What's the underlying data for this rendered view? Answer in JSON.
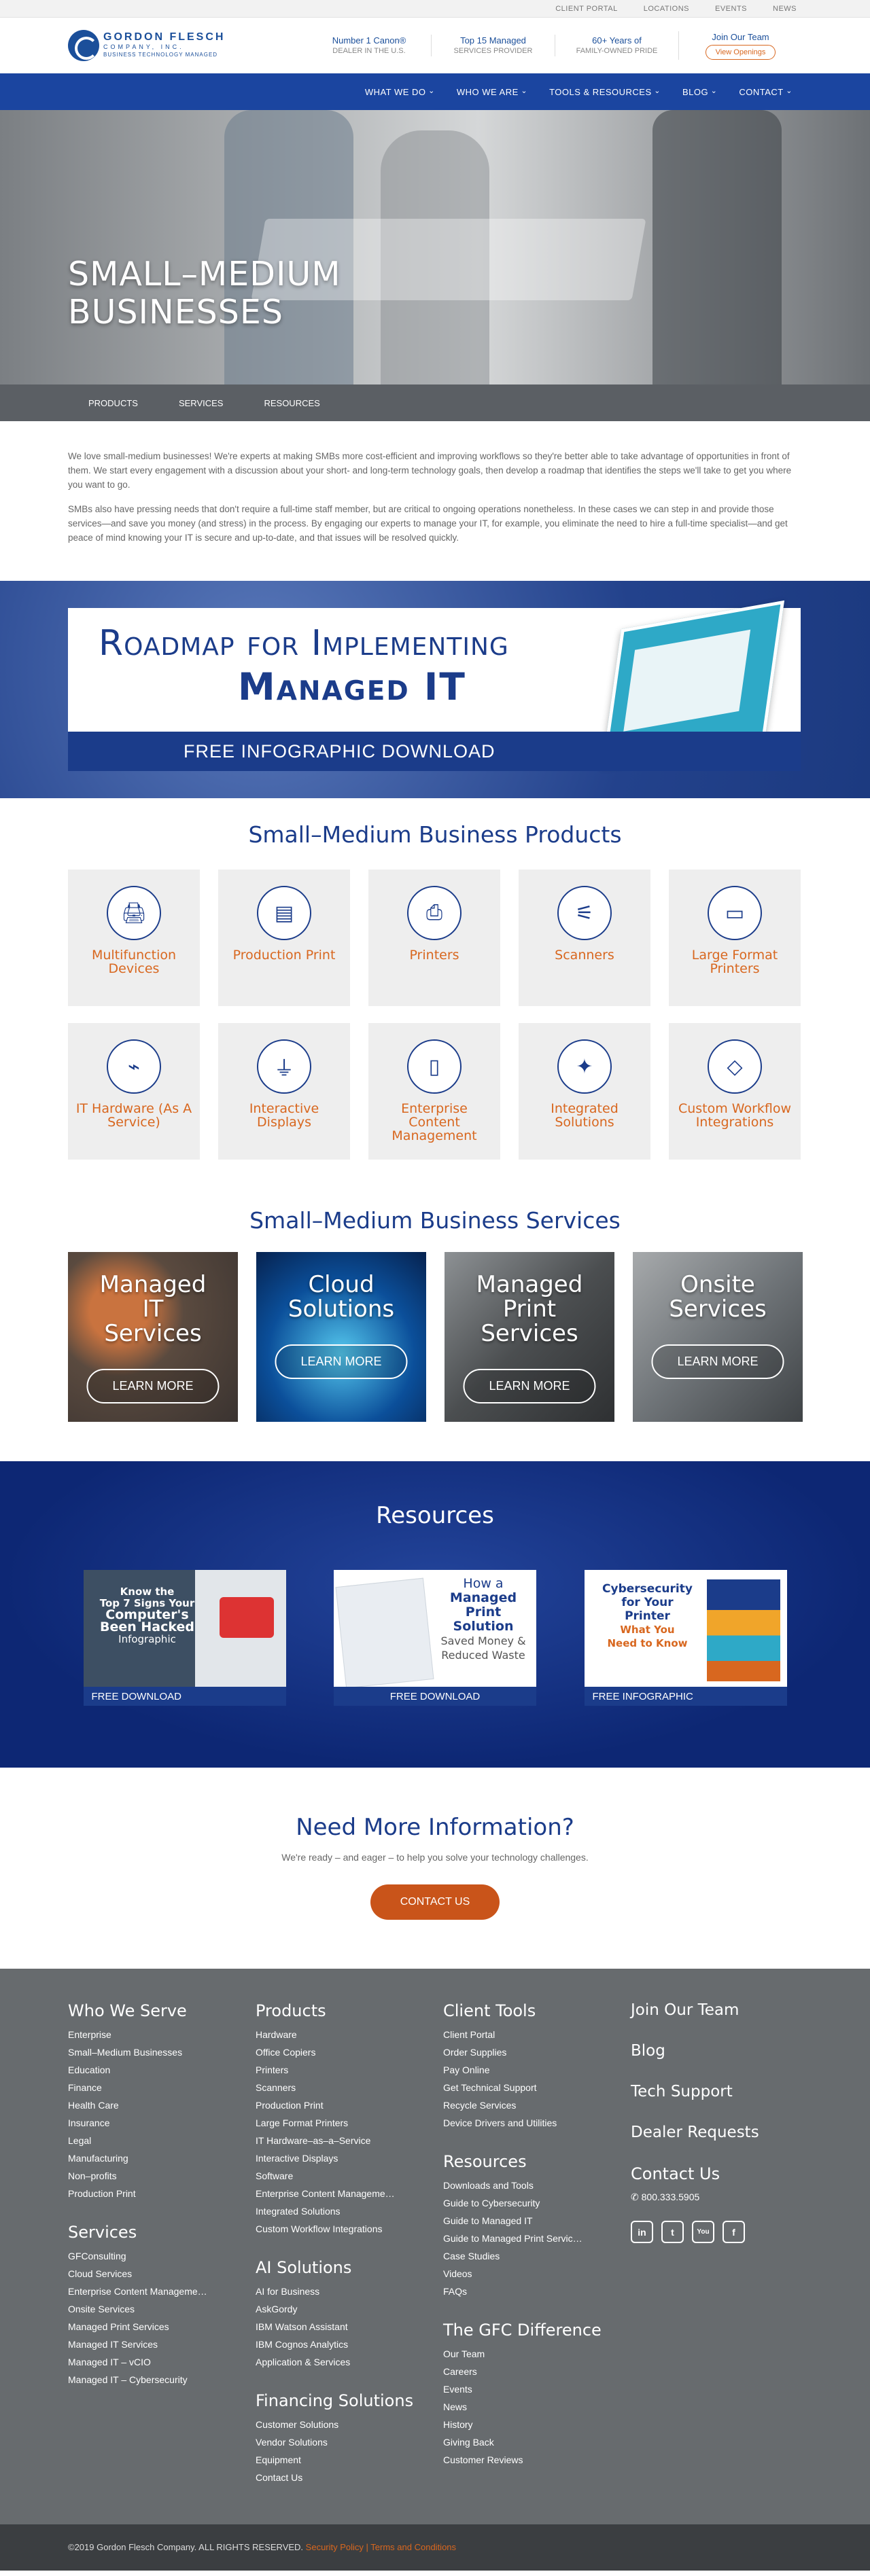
{
  "util_links": [
    "CLIENT PORTAL",
    "LOCATIONS",
    "EVENTS",
    "NEWS"
  ],
  "logo": {
    "name": "GORDON FLESCH",
    "sub": "COMPANY, INC.",
    "tag": "BUSINESS TECHNOLOGY MANAGED"
  },
  "stats": [
    {
      "line1": "Number 1 Canon®",
      "line2": "DEALER IN THE U.S."
    },
    {
      "line1": "Top 15 Managed",
      "line2": "SERVICES PROVIDER"
    },
    {
      "line1": "60+ Years of",
      "line2": "FAMILY-OWNED PRIDE"
    },
    {
      "line1": "Join Our Team",
      "button": "View Openings"
    }
  ],
  "nav": [
    "WHAT WE DO",
    "WHO WE ARE",
    "TOOLS & RESOURCES",
    "BLOG",
    "CONTACT"
  ],
  "hero": {
    "title_l1": "SMALL–MEDIUM",
    "title_l2": "BUSINESSES"
  },
  "subnav": [
    "PRODUCTS",
    "SERVICES",
    "RESOURCES"
  ],
  "intro": [
    "We love small-medium businesses! We're experts at making SMBs more cost-efficient and improving workflows so they're better able to take advantage of opportunities in front of them. We start every engagement with a discussion about your short- and long-term technology goals, then develop a roadmap that identifies the steps we'll take to get you where you want to go.",
    "SMBs also have pressing needs that don't require a full-time staff member, but are critical to ongoing operations nonetheless. In these cases we can step in and provide those services—and save you money (and stress) in the process. By engaging our experts to manage your IT, for example, you eliminate the need to hire a full-time specialist—and get peace of mind knowing your IT is secure and up-to-date, and that issues will be resolved quickly."
  ],
  "banner": {
    "line1": "Roadmap for Implementing",
    "line2": "Managed IT",
    "line3": "FREE INFOGRAPHIC DOWNLOAD"
  },
  "products": {
    "title": "Small–Medium Business Products",
    "items": [
      {
        "label": "Multifunction Devices",
        "icon": "mfp-icon",
        "glyph": "🖨"
      },
      {
        "label": "Production Print",
        "icon": "production-print-icon",
        "glyph": "▤"
      },
      {
        "label": "Printers",
        "icon": "printer-icon",
        "glyph": "⎙"
      },
      {
        "label": "Scanners",
        "icon": "scanner-icon",
        "glyph": "⚟"
      },
      {
        "label": "Large Format Printers",
        "icon": "large-format-icon",
        "glyph": "▭"
      },
      {
        "label": "IT Hardware (As A Service)",
        "icon": "router-icon",
        "glyph": "⌁"
      },
      {
        "label": "Interactive Displays",
        "icon": "usb-icon",
        "glyph": "⏚"
      },
      {
        "label": "Enterprise Content Management",
        "icon": "ecm-icon",
        "glyph": "▯"
      },
      {
        "label": "Integrated Solutions",
        "icon": "puzzle-icon",
        "glyph": "✦"
      },
      {
        "label": "Custom Workflow Integrations",
        "icon": "workflow-icon",
        "glyph": "◇"
      }
    ]
  },
  "services": {
    "title": "Small–Medium Business Services",
    "items": [
      {
        "title": "Managed IT Services",
        "cta": "LEARN MORE",
        "bg": "#5a4a3f"
      },
      {
        "title": "Cloud Solutions",
        "cta": "LEARN MORE",
        "bg": "#0b4f9a"
      },
      {
        "title": "Managed Print Services",
        "cta": "LEARN MORE",
        "bg": "#4b4e50"
      },
      {
        "title": "Onsite Services",
        "cta": "LEARN MORE",
        "bg": "#6f7478"
      }
    ]
  },
  "resources": {
    "title": "Resources",
    "items": [
      {
        "text_l1": "Know the",
        "text_l2": "Top 7 Signs Your",
        "text_l3": "Computer's",
        "text_l4": "Been Hacked",
        "text_l5": "Infographic",
        "cta": "FREE DOWNLOAD"
      },
      {
        "text_l1": "How a",
        "text_l2": "Managed",
        "text_l3": "Print",
        "text_l4": "Solution",
        "text_l5": "Saved Money &",
        "text_l6": "Reduced Waste",
        "cta": "FREE DOWNLOAD"
      },
      {
        "text_l1": "Cybersecurity",
        "text_l2": "for Your",
        "text_l3": "Printer",
        "text_l4": "What You",
        "text_l5": "Need to Know",
        "cta": "FREE INFOGRAPHIC"
      }
    ]
  },
  "more": {
    "title": "Need More Information?",
    "text": "We're ready – and eager – to help you solve your technology challenges.",
    "cta": "CONTACT US"
  },
  "footer": {
    "who": {
      "title": "Who We Serve",
      "links": [
        "Enterprise",
        "Small–Medium Businesses",
        "Education",
        "Finance",
        "Health Care",
        "Insurance",
        "Legal",
        "Manufacturing",
        "Non–profits",
        "Production Print"
      ]
    },
    "services": {
      "title": "Services",
      "links": [
        "GFConsulting",
        "Cloud Services",
        "Enterprise Content Manageme…",
        "Onsite Services",
        "Managed Print Services",
        "Managed IT Services",
        "Managed IT – vCIO",
        "Managed IT – Cybersecurity"
      ]
    },
    "products": {
      "title": "Products",
      "links": [
        "Hardware",
        "Office Copiers",
        "Printers",
        "Scanners",
        "Production Print",
        "Large Format Printers",
        "IT Hardware–as–a–Service",
        "Interactive Displays",
        "Software",
        "Enterprise Content Manageme…",
        "Integrated Solutions",
        "Custom Workflow Integrations"
      ]
    },
    "ai": {
      "title": "AI Solutions",
      "links": [
        "AI for Business",
        "AskGordy",
        "IBM Watson Assistant",
        "IBM Cognos Analytics",
        "Application & Services"
      ]
    },
    "financing": {
      "title": "Financing Solutions",
      "links": [
        "Customer Solutions",
        "Vendor Solutions",
        "Equipment",
        "Contact Us"
      ]
    },
    "tools": {
      "title": "Client Tools",
      "links": [
        "Client Portal",
        "Order Supplies",
        "Pay Online",
        "Get Technical Support",
        "Recycle Services",
        "Device Drivers and Utilities"
      ]
    },
    "res": {
      "title": "Resources",
      "links": [
        "Downloads and Tools",
        "Guide to Cybersecurity",
        "Guide to Managed IT",
        "Guide to Managed Print Servic…",
        "Case Studies",
        "Videos",
        "FAQs"
      ]
    },
    "gfc": {
      "title": "The GFC Difference",
      "links": [
        "Our Team",
        "Careers",
        "Events",
        "News",
        "History",
        "Giving Back",
        "Customer Reviews"
      ]
    },
    "right": {
      "links": [
        "Join Our Team",
        "Blog",
        "Tech Support",
        "Dealer Requests"
      ],
      "contact": "Contact Us",
      "phone": "800.333.5905",
      "social": [
        "in",
        "t",
        "You",
        "f"
      ]
    }
  },
  "copyright": {
    "text": "©2019 Gordon Flesch Company. ALL RIGHTS RESERVED.",
    "privacy": "Security Policy",
    "sep": " | ",
    "terms": "Terms and Conditions"
  }
}
